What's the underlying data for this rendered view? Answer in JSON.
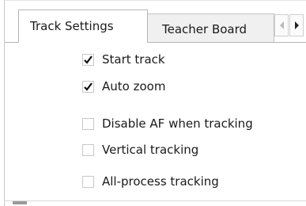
{
  "tabs": [
    {
      "label": "Track Settings",
      "active": true
    },
    {
      "label": "Teacher Board",
      "active": false
    }
  ],
  "scroll_arrows": {
    "left_icon": "arrow-left-icon",
    "right_icon": "arrow-right-icon"
  },
  "options": [
    {
      "label": "Start track",
      "checked": true
    },
    {
      "label": "Auto zoom",
      "checked": true
    },
    {
      "label": "Disable AF when tracking",
      "checked": false
    },
    {
      "label": "Vertical tracking",
      "checked": false
    },
    {
      "label": "All-process tracking",
      "checked": false
    }
  ],
  "colors": {
    "tab_border": "#b5b5b5",
    "inactive_tab_bg": "#f0f0f0",
    "checkbox_border": "#c8c8c8",
    "text": "#1a1a1a"
  }
}
